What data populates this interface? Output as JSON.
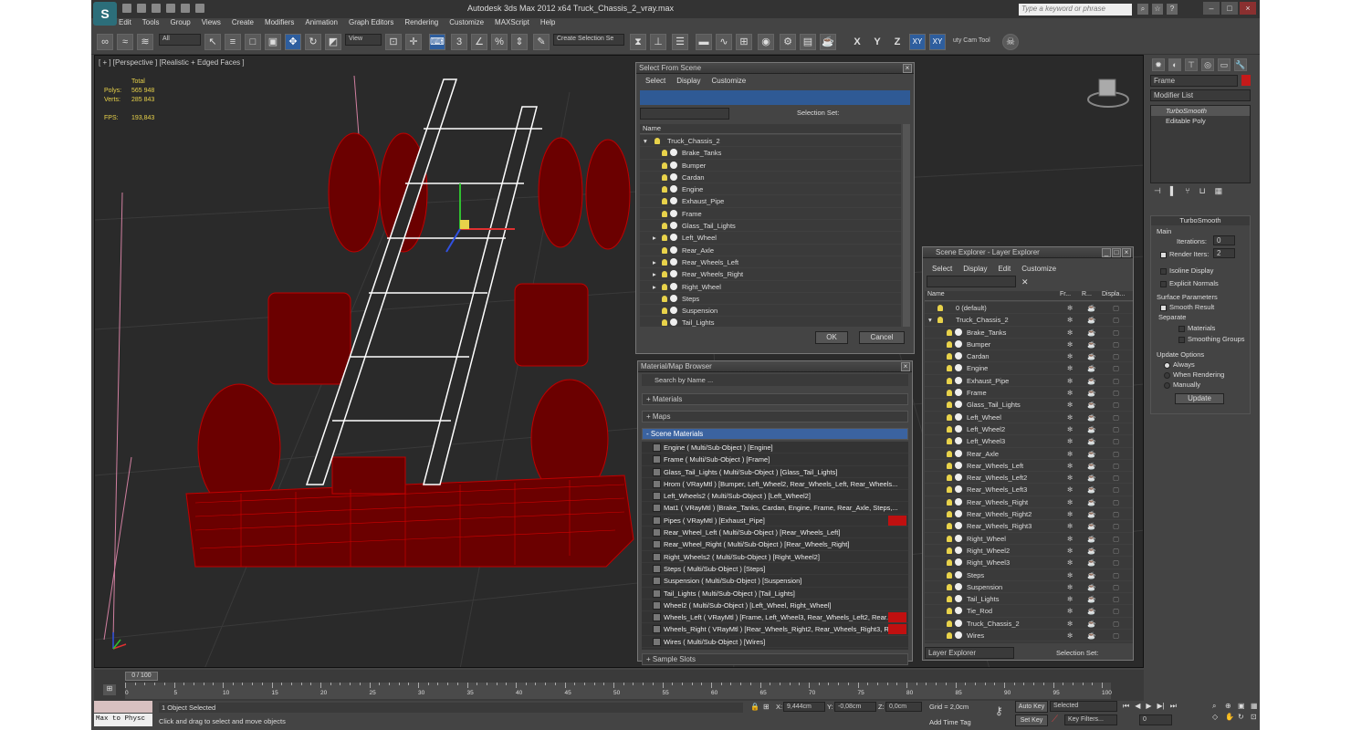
{
  "app": {
    "title": "Autodesk 3ds Max  2012 x64    Truck_Chassis_2_vray.max",
    "logo": "S",
    "search_placeholder": "Type a keyword or phrase"
  },
  "menu": [
    "Edit",
    "Tools",
    "Group",
    "Views",
    "Create",
    "Modifiers",
    "Animation",
    "Graph Editors",
    "Rendering",
    "Customize",
    "MAXScript",
    "Help"
  ],
  "toolbar": {
    "filter": "All",
    "ref_coord": "View",
    "selection_set": "Create Selection Se",
    "axes": [
      "X",
      "Y",
      "Z",
      "XY",
      "XY"
    ],
    "cam_tool": "uty Cam Tool"
  },
  "viewport": {
    "label": "[ + ] [Perspective ] [Realistic + Edged Faces ]",
    "stats_header": "Total",
    "stats": [
      {
        "k": "Polys:",
        "v": "565 948"
      },
      {
        "k": "Verts:",
        "v": "285 843"
      },
      {
        "k": "FPS:",
        "v": "193,843"
      }
    ]
  },
  "select_from_scene": {
    "title": "Select From Scene",
    "menu": [
      "Select",
      "Display",
      "Customize"
    ],
    "selection_set_label": "Selection Set:",
    "column": "Name",
    "root": "Truck_Chassis_2",
    "items": [
      "Brake_Tanks",
      "Bumper",
      "Cardan",
      "Engine",
      "Exhaust_Pipe",
      "Frame",
      "Glass_Tail_Lights",
      "Left_Wheel",
      "Rear_Axle",
      "Rear_Wheels_Left",
      "Rear_Wheels_Right",
      "Right_Wheel",
      "Steps",
      "Suspension",
      "Tail_Lights"
    ],
    "ok": "OK",
    "cancel": "Cancel"
  },
  "material_browser": {
    "title": "Material/Map Browser",
    "search": "Search by Name ...",
    "sections": [
      "+ Materials",
      "+ Maps",
      "- Scene Materials"
    ],
    "materials": [
      "Engine  ( Multi/Sub-Object )  [Engine]",
      "Frame  ( Multi/Sub-Object )  [Frame]",
      "Glass_Tail_Lights  ( Multi/Sub-Object )  [Glass_Tail_Lights]",
      "Hrom  ( VRayMtl )  [Bumper, Left_Wheel2, Rear_Wheels_Left, Rear_Wheels...",
      "Left_Wheels2  ( Multi/Sub-Object )  [Left_Wheel2]",
      "Mat1  ( VRayMtl )  [Brake_Tanks, Cardan, Engine, Frame, Rear_Axle, Steps,...",
      "Pipes  ( VRayMtl )  [Exhaust_Pipe]",
      "Rear_Wheel_Left  ( Multi/Sub-Object )  [Rear_Wheels_Left]",
      "Rear_Wheel_Right  ( Multi/Sub-Object )  [Rear_Wheels_Right]",
      "Right_Wheels2  ( Multi/Sub-Object )  [Right_Wheel2]",
      "Steps  ( Multi/Sub-Object )  [Steps]",
      "Suspension  ( Multi/Sub-Object )  [Suspension]",
      "Tail_Lights  ( Multi/Sub-Object )  [Tail_Lights]",
      "Wheel2  ( Multi/Sub-Object )  [Left_Wheel, Right_Wheel]",
      "Wheels_Left  ( VRayMtl )  [Frame, Left_Wheel3, Rear_Wheels_Left2, Rear...",
      "Wheels_Right  ( VRayMtl )  [Rear_Wheels_Right2, Rear_Wheels_Right3, Rig...",
      "Wires  ( Multi/Sub-Object )  [Wires]"
    ],
    "footer": "+ Sample Slots"
  },
  "scene_explorer": {
    "title": "Scene Explorer - Layer Explorer",
    "menu": [
      "Select",
      "Display",
      "Edit",
      "Customize"
    ],
    "columns": [
      "Name",
      "Fr...",
      "R...",
      "Displa..."
    ],
    "default_layer": "0 (default)",
    "root": "Truck_Chassis_2",
    "items": [
      "Brake_Tanks",
      "Bumper",
      "Cardan",
      "Engine",
      "Exhaust_Pipe",
      "Frame",
      "Glass_Tail_Lights",
      "Left_Wheel",
      "Left_Wheel2",
      "Left_Wheel3",
      "Rear_Axle",
      "Rear_Wheels_Left",
      "Rear_Wheels_Left2",
      "Rear_Wheels_Left3",
      "Rear_Wheels_Right",
      "Rear_Wheels_Right2",
      "Rear_Wheels_Right3",
      "Right_Wheel",
      "Right_Wheel2",
      "Right_Wheel3",
      "Steps",
      "Suspension",
      "Tail_Lights",
      "Tie_Rod",
      "Truck_Chassis_2",
      "Wires"
    ],
    "footer_dropdown": "Layer Explorer",
    "selection_set_label": "Selection Set:"
  },
  "command_panel": {
    "object_name": "Frame",
    "modifier_list": "Modifier List",
    "stack": [
      "TurboSmooth",
      "Editable Poly"
    ],
    "turbosmooth": {
      "title": "TurboSmooth",
      "main": "Main",
      "iterations_label": "Iterations:",
      "iterations": "0",
      "render_iters_label": "Render Iters:",
      "render_iters": "2",
      "isoline": "Isoline Display",
      "explicit": "Explicit Normals",
      "surface": "Surface Parameters",
      "smooth_result": "Smooth Result",
      "separate": "Separate",
      "materials": "Materials",
      "smoothing_groups": "Smoothing Groups",
      "update_options": "Update Options",
      "always": "Always",
      "when_rendering": "When Rendering",
      "manually": "Manually",
      "update": "Update"
    }
  },
  "timeline": {
    "slider": "0 / 100",
    "ticks": [
      "0",
      "5",
      "10",
      "15",
      "20",
      "25",
      "30",
      "35",
      "40",
      "45",
      "50",
      "55",
      "60",
      "65",
      "70",
      "75",
      "80",
      "85",
      "90",
      "95",
      "100"
    ]
  },
  "status": {
    "script_label": "Max to Physc",
    "selected": "1 Object Selected",
    "prompt": "Click and drag to select and move objects",
    "x_label": "X:",
    "x": "9,444cm",
    "y_label": "Y:",
    "y": "-0,08cm",
    "z_label": "Z:",
    "z": "0,0cm",
    "grid": "Grid = 2,0cm",
    "auto_key": "Auto Key",
    "set_key": "Set Key",
    "key_mode": "Selected",
    "key_filters": "Key Filters...",
    "add_time_tag": "Add Time Tag",
    "frame": "0"
  },
  "colors": {
    "wire_red": "#8b0000",
    "accent_blue": "#3b63a0",
    "stats_yellow": "#e8d24a"
  }
}
